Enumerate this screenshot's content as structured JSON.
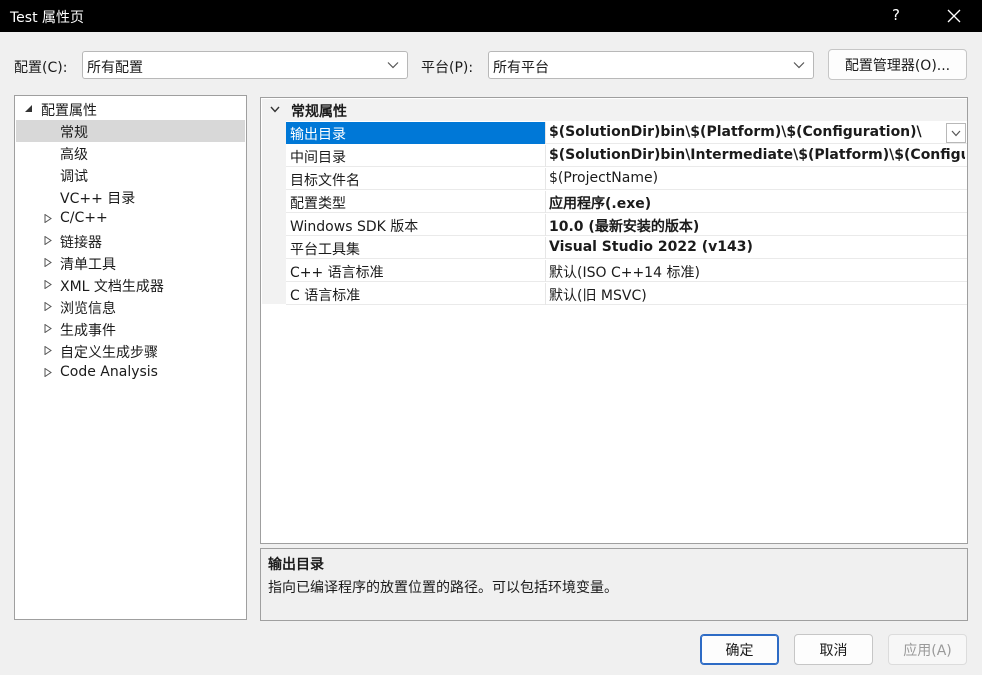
{
  "window": {
    "title": "Test 属性页",
    "help_label": "?"
  },
  "toolbar": {
    "config_label": "配置(C):",
    "config_value": "所有配置",
    "platform_label": "平台(P):",
    "platform_value": "所有平台",
    "config_manager_label": "配置管理器(O)..."
  },
  "tree": {
    "root": {
      "label": "配置属性",
      "expanded": true
    },
    "items": [
      {
        "label": "常规",
        "selected": true,
        "expandable": false
      },
      {
        "label": "高级",
        "expandable": false
      },
      {
        "label": "调试",
        "expandable": false
      },
      {
        "label": "VC++ 目录",
        "expandable": false
      },
      {
        "label": "C/C++",
        "expandable": true
      },
      {
        "label": "链接器",
        "expandable": true
      },
      {
        "label": "清单工具",
        "expandable": true
      },
      {
        "label": "XML 文档生成器",
        "expandable": true
      },
      {
        "label": "浏览信息",
        "expandable": true
      },
      {
        "label": "生成事件",
        "expandable": true
      },
      {
        "label": "自定义生成步骤",
        "expandable": true
      },
      {
        "label": "Code Analysis",
        "expandable": true
      }
    ]
  },
  "grid": {
    "category": "常规属性",
    "properties": [
      {
        "name": "输出目录",
        "value": "$(SolutionDir)bin\\$(Platform)\\$(Configuration)\\",
        "bold": true,
        "selected": true
      },
      {
        "name": "中间目录",
        "value": "$(SolutionDir)bin\\Intermediate\\$(Platform)\\$(Configura",
        "bold": true
      },
      {
        "name": "目标文件名",
        "value": "$(ProjectName)",
        "bold": false
      },
      {
        "name": "配置类型",
        "value": "应用程序(.exe)",
        "bold": true
      },
      {
        "name": "Windows SDK 版本",
        "value": "10.0 (最新安装的版本)",
        "bold": true
      },
      {
        "name": "平台工具集",
        "value": "Visual Studio 2022 (v143)",
        "bold": true
      },
      {
        "name": "C++ 语言标准",
        "value": "默认(ISO C++14 标准)",
        "bold": false
      },
      {
        "name": "C 语言标准",
        "value": "默认(旧 MSVC)",
        "bold": false
      }
    ]
  },
  "description": {
    "title": "输出目录",
    "text": "指向已编译程序的放置位置的路径。可以包括环境变量。"
  },
  "buttons": {
    "ok": "确定",
    "cancel": "取消",
    "apply": "应用(A)"
  },
  "colors": {
    "selection": "#0078d7",
    "titlebar": "#000000"
  }
}
